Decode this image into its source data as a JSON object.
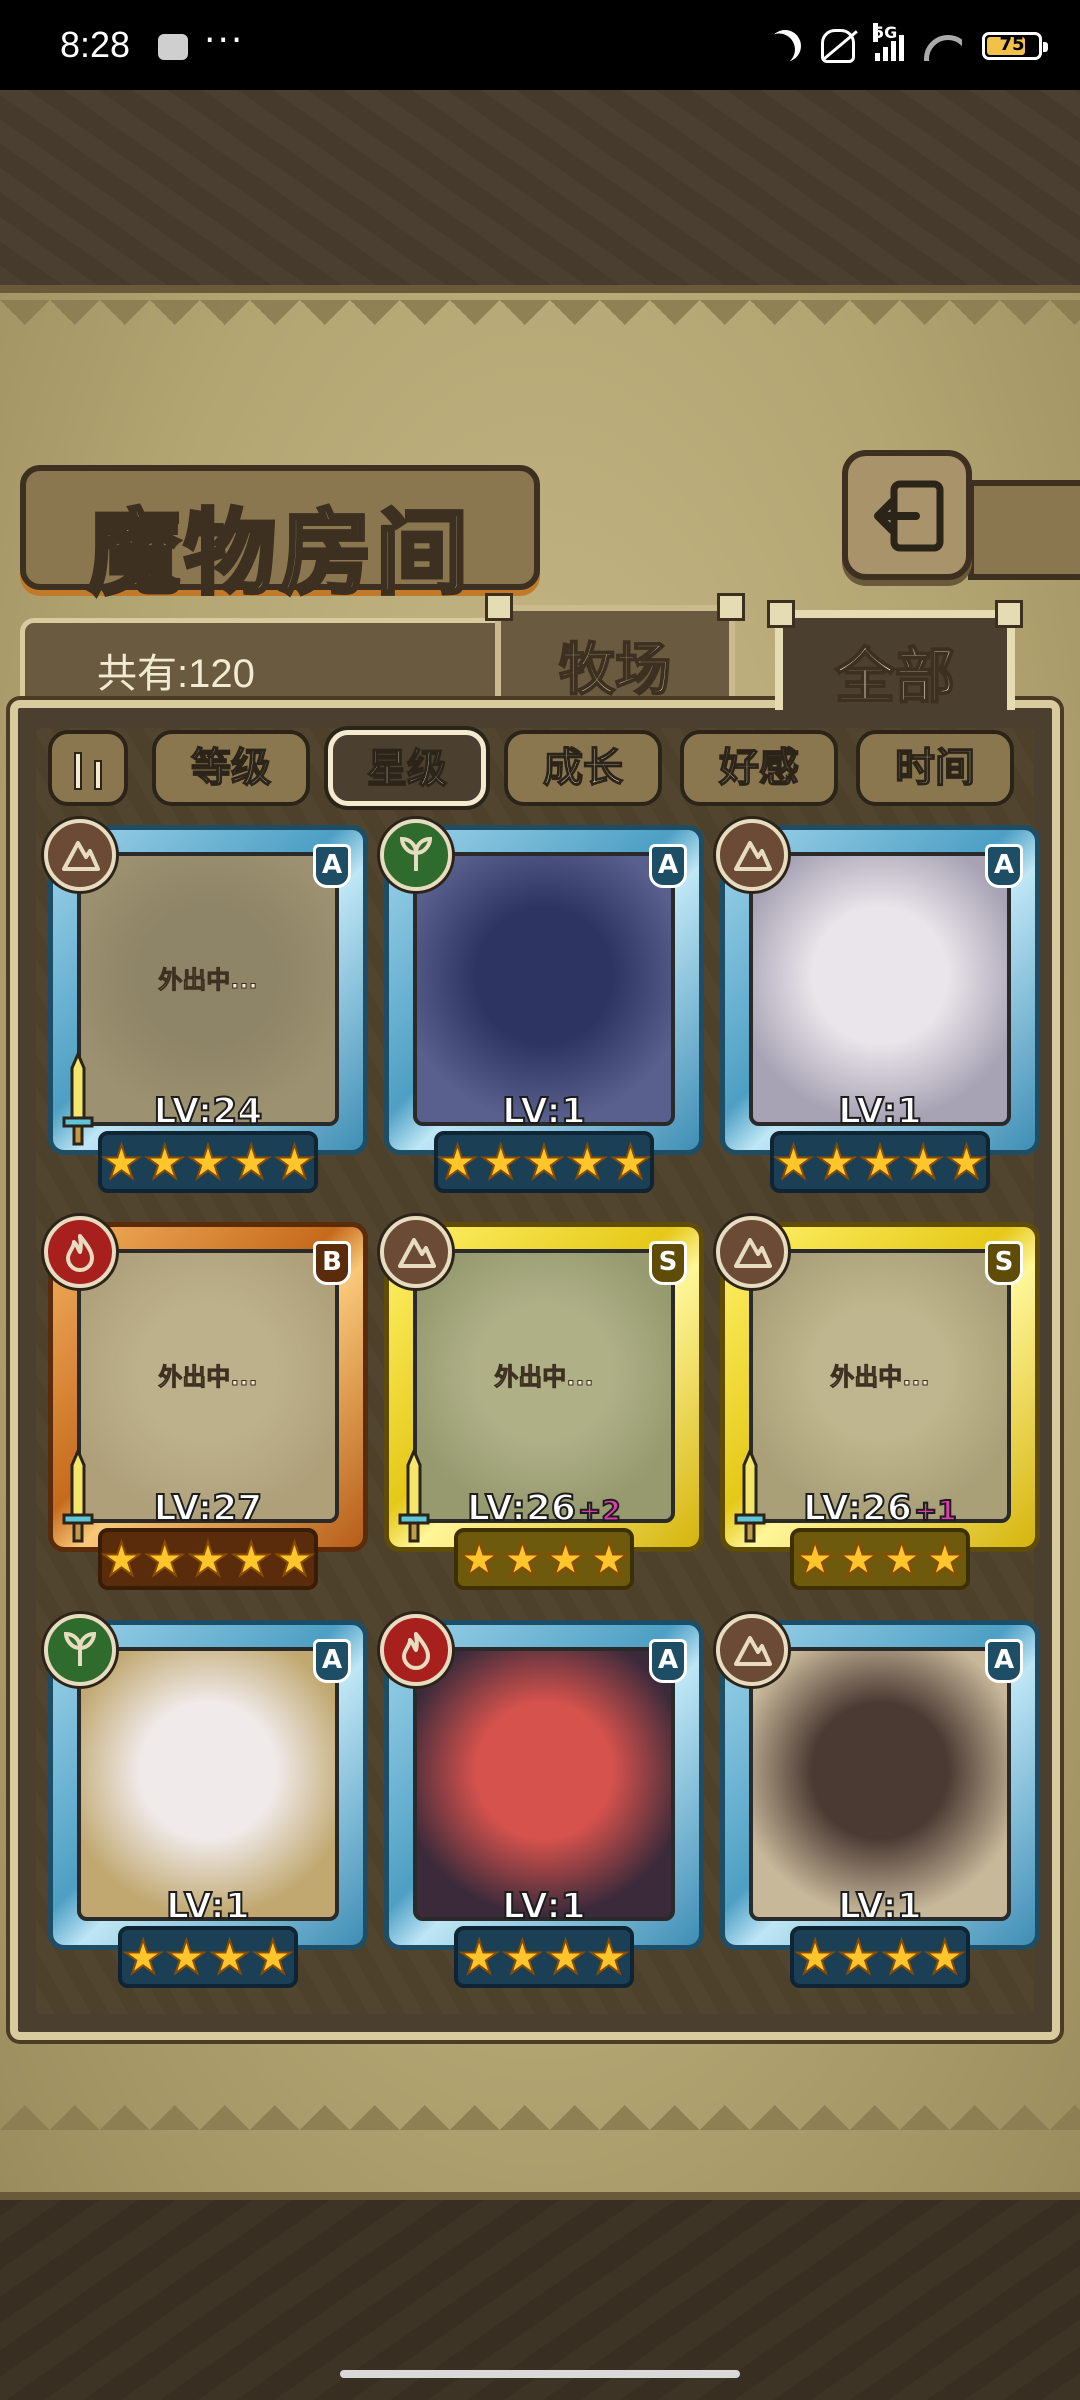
{
  "status_bar": {
    "time": "8:28",
    "network": "5G",
    "battery": "75"
  },
  "header": {
    "title": "魔物房间"
  },
  "summary": {
    "count_label": "共有:120"
  },
  "tabs": [
    {
      "label": "牧场"
    },
    {
      "label": "全部"
    }
  ],
  "sort_buttons": [
    {
      "label": "等级"
    },
    {
      "label": "星级",
      "active": true
    },
    {
      "label": "成长"
    },
    {
      "label": "好感"
    },
    {
      "label": "时间"
    }
  ],
  "cards": [
    {
      "rank": "A",
      "element": "earth",
      "level": "LV:24",
      "bonus": "",
      "away": "外出中...",
      "stars": 5,
      "frame": "A"
    },
    {
      "rank": "A",
      "element": "plant",
      "level": "LV:1",
      "bonus": "",
      "away": "",
      "stars": 5,
      "frame": "A"
    },
    {
      "rank": "A",
      "element": "earth",
      "level": "LV:1",
      "bonus": "",
      "away": "",
      "stars": 5,
      "frame": "A"
    },
    {
      "rank": "B",
      "element": "fire",
      "level": "LV:27",
      "bonus": "",
      "away": "外出中...",
      "stars": 5,
      "frame": "B"
    },
    {
      "rank": "S",
      "element": "earth",
      "level": "LV:26",
      "bonus": "+2",
      "away": "外出中...",
      "stars": 4,
      "frame": "S"
    },
    {
      "rank": "S",
      "element": "earth",
      "level": "LV:26",
      "bonus": "+1",
      "away": "外出中...",
      "stars": 4,
      "frame": "S"
    },
    {
      "rank": "A",
      "element": "plant",
      "level": "LV:1",
      "bonus": "",
      "away": "",
      "stars": 4,
      "frame": "A"
    },
    {
      "rank": "A",
      "element": "fire",
      "level": "LV:1",
      "bonus": "",
      "away": "",
      "stars": 4,
      "frame": "A"
    },
    {
      "rank": "A",
      "element": "earth",
      "level": "LV:1",
      "bonus": "",
      "away": "",
      "stars": 4,
      "frame": "A"
    }
  ]
}
